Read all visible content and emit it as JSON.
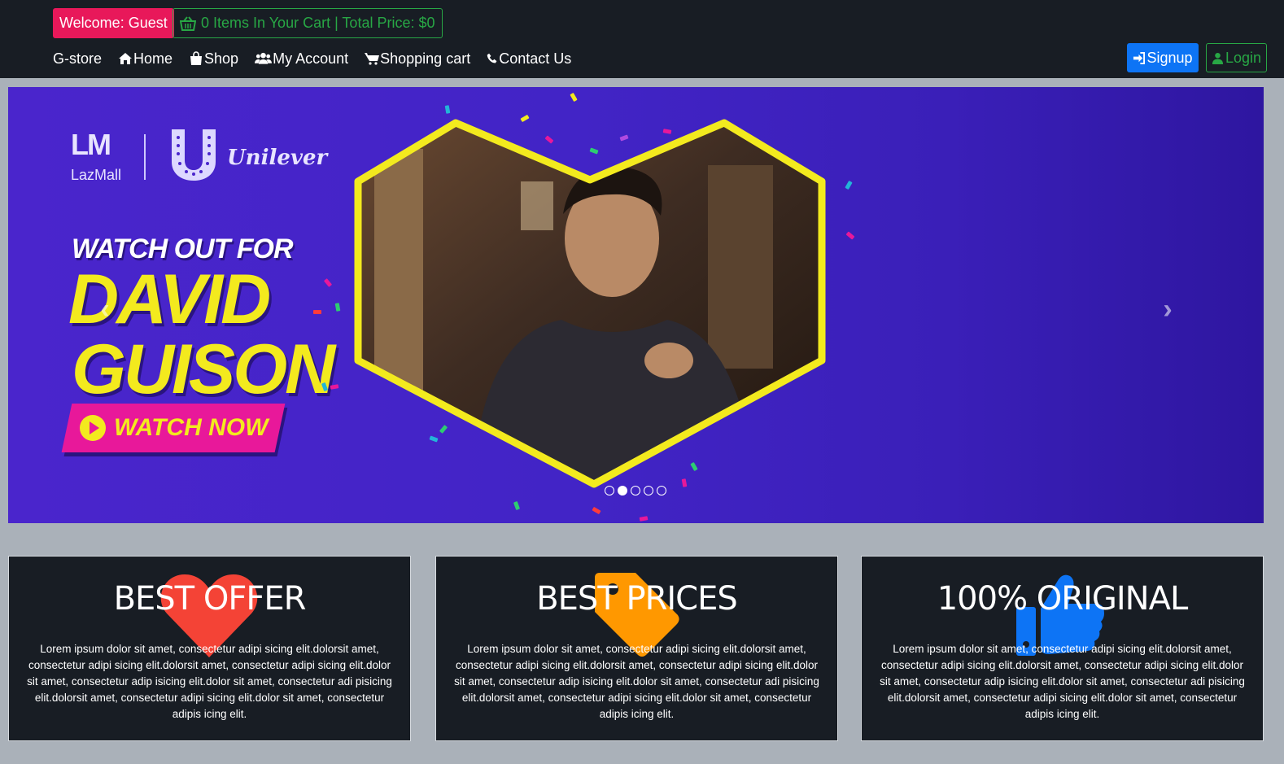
{
  "header": {
    "welcome": "Welcome: Guest",
    "cart_text": "0 Items In Your Cart | Total Price: $0",
    "brand": "G-store",
    "nav": [
      {
        "label": "Home",
        "icon": "home-icon"
      },
      {
        "label": "Shop",
        "icon": "shopping-bag-icon"
      },
      {
        "label": "My Account",
        "icon": "users-icon"
      },
      {
        "label": "Shopping cart",
        "icon": "shopping-cart-icon"
      },
      {
        "label": "Contact Us",
        "icon": "phone-icon"
      }
    ],
    "signup": "Signup",
    "login": "Login"
  },
  "carousel": {
    "logo_lm": "LM",
    "logo_lazmall": "LazMall",
    "logo_unilever": "Unilever",
    "headline_top": "WATCH OUT FOR",
    "headline_1": "DAVID",
    "headline_2": "GUISON",
    "cta": "WATCH NOW",
    "prev": "‹",
    "next": "›",
    "slide_count": 5,
    "active_slide": 2
  },
  "features": [
    {
      "title": "BEST OFFER",
      "icon": "heart-icon",
      "color": "#f44336",
      "text": "Lorem ipsum dolor sit amet, consectetur adipi sicing elit.dolorsit amet, consectetur adipi sicing elit.dolorsit amet, consectetur adipi sicing elit.dolor sit amet, consectetur adip isicing elit.dolor sit amet, consectetur adi pisicing elit.dolorsit amet, consectetur adipi sicing elit.dolor sit amet, consectetur adipis icing elit."
    },
    {
      "title": "BEST PRICES",
      "icon": "price-tag-icon",
      "color": "#ff9800",
      "text": "Lorem ipsum dolor sit amet, consectetur adipi sicing elit.dolorsit amet, consectetur adipi sicing elit.dolorsit amet, consectetur adipi sicing elit.dolor sit amet, consectetur adip isicing elit.dolor sit amet, consectetur adi pisicing elit.dolorsit amet, consectetur adipi sicing elit.dolor sit amet, consectetur adipis icing elit."
    },
    {
      "title": "100% ORIGINAL",
      "icon": "thumbs-up-icon",
      "color": "#0d74f5",
      "text": "Lorem ipsum dolor sit amet, consectetur adipi sicing elit.dolorsit amet, consectetur adipi sicing elit.dolorsit amet, consectetur adipi sicing elit.dolor sit amet, consectetur adip isicing elit.dolor sit amet, consectetur adi pisicing elit.dolorsit amet, consectetur adipi sicing elit.dolor sit amet, consectetur adipis icing elit."
    }
  ]
}
